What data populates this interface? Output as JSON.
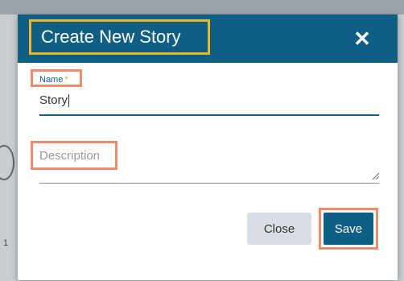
{
  "dialog": {
    "title": "Create New Story",
    "close_icon": "close-icon",
    "header_color": "#0f5f84",
    "title_highlight_color": "#f0b428",
    "field_highlight_color": "#ef8a6a"
  },
  "form": {
    "name_label": "Name",
    "name_required_marker": "*",
    "name_value": "Story",
    "description_placeholder": "Description"
  },
  "buttons": {
    "close_label": "Close",
    "save_label": "Save"
  },
  "background": {
    "edge_char": "1"
  }
}
